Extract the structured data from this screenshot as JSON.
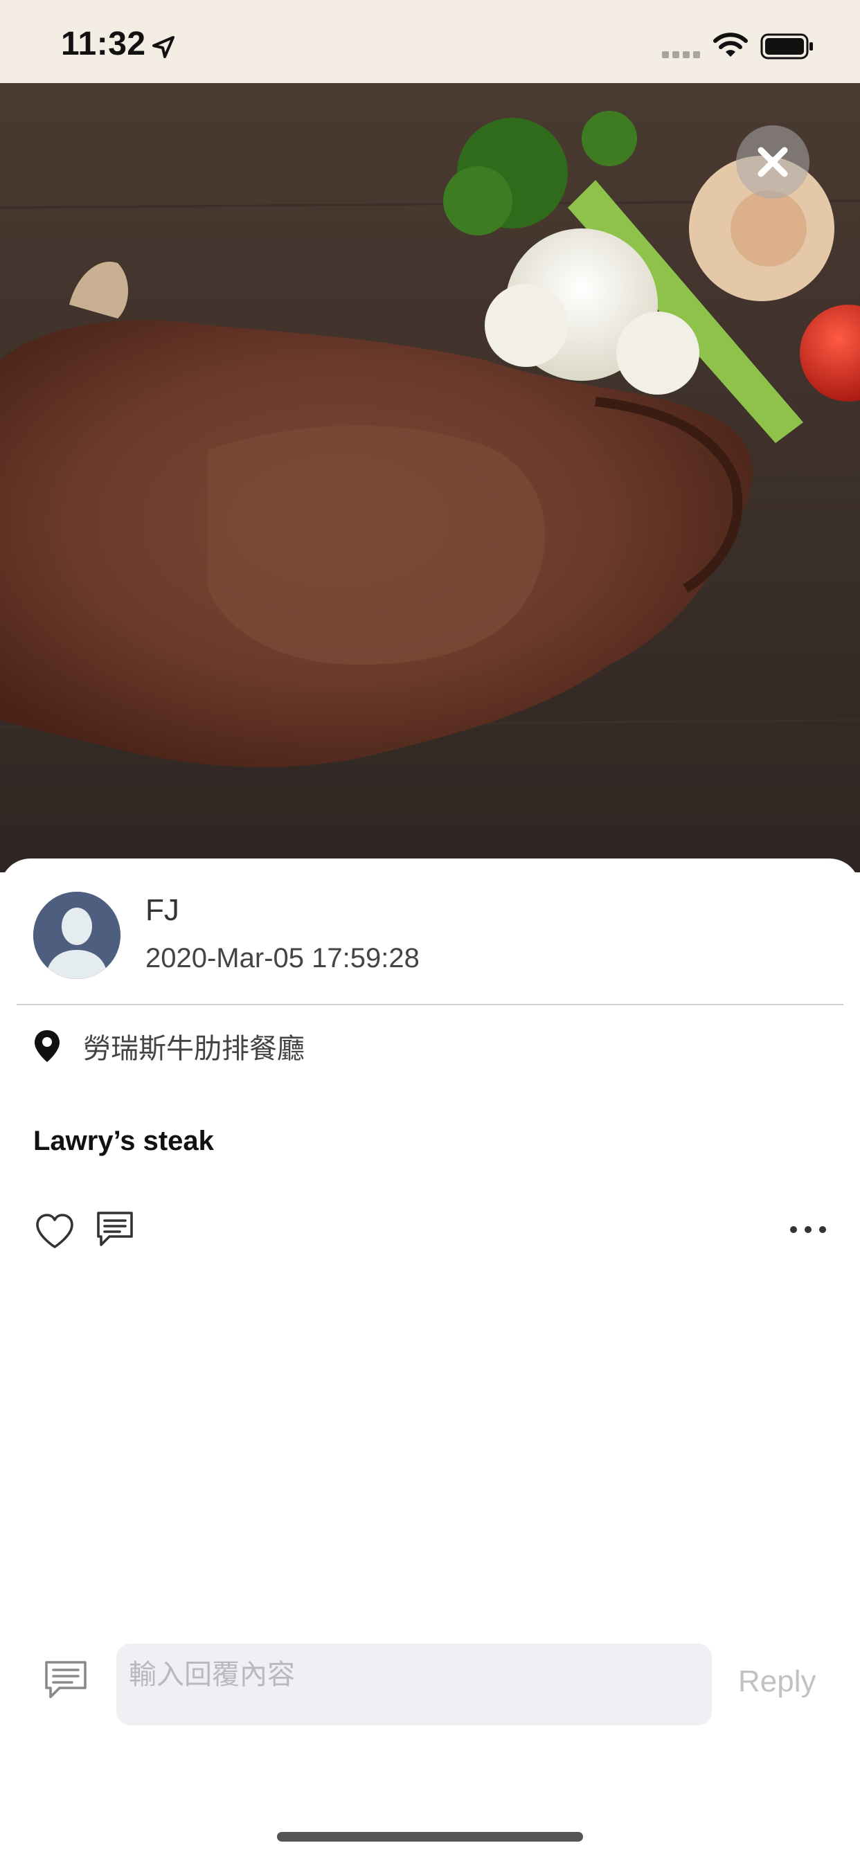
{
  "status_bar": {
    "time": "11:32",
    "icons": [
      "location-arrow-icon",
      "signal-icon",
      "wifi-icon",
      "battery-icon"
    ]
  },
  "photo": {
    "subject": "steak-with-vegetables",
    "close_icon": "close-icon"
  },
  "post": {
    "user_name": "FJ",
    "timestamp": "2020-Mar-05 17:59:28",
    "location": "勞瑞斯牛肋排餐廳",
    "caption": "Lawry’s steak",
    "actions": {
      "like_icon": "heart-icon",
      "comment_icon": "comment-icon",
      "more_icon": "more-icon"
    }
  },
  "reply": {
    "placeholder": "輸入回覆內容",
    "button_label": "Reply"
  },
  "colors": {
    "avatar_bg": "#4e5e7f",
    "input_bg": "#f0f0f4",
    "reply_disabled": "#c2c2c6"
  }
}
